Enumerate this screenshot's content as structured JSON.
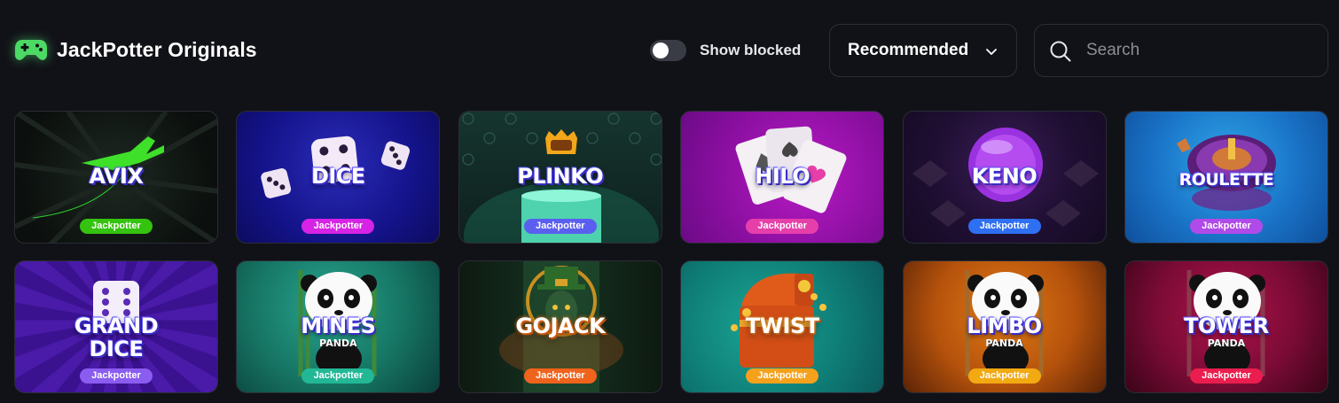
{
  "header": {
    "title": "JackPotter Originals",
    "title_icon": "gamepad-icon",
    "accent_color": "#4cd964"
  },
  "filters": {
    "show_blocked_label": "Show blocked",
    "show_blocked_on": false,
    "sort_selected": "Recommended",
    "search_placeholder": "Search"
  },
  "games": [
    {
      "title": "AVIX",
      "badge": "Jackpotter",
      "badge_color": "#34c30f"
    },
    {
      "title": "DICE",
      "badge": "Jackpotter",
      "badge_color": "#d623e6"
    },
    {
      "title": "PLINKO",
      "badge": "Jackpotter",
      "badge_color": "#5a5ff0"
    },
    {
      "title": "HILO",
      "badge": "Jackpotter",
      "badge_color": "#e63fa9"
    },
    {
      "title": "KENO",
      "badge": "Jackpotter",
      "badge_color": "#2f6ff2"
    },
    {
      "title": "ROULETTE",
      "badge": "Jackpotter",
      "badge_color": "#b04ae8"
    },
    {
      "title": "GRAND",
      "title2": "DICE",
      "badge": "Jackpotter",
      "badge_color": "#8a5cf0"
    },
    {
      "title": "MINES",
      "subtitle": "PANDA",
      "badge": "Jackpotter",
      "badge_color": "#22b896"
    },
    {
      "title": "GOJACK",
      "badge": "Jackpotter",
      "badge_color": "#f0631c"
    },
    {
      "title": "TWIST",
      "badge": "Jackpotter",
      "badge_color": "#f5a11c"
    },
    {
      "title": "LIMBO",
      "subtitle": "PANDA",
      "badge": "Jackpotter",
      "badge_color": "#f2a912"
    },
    {
      "title": "TOWER",
      "subtitle": "PANDA",
      "badge": "Jackpotter",
      "badge_color": "#ea1e4e"
    }
  ]
}
